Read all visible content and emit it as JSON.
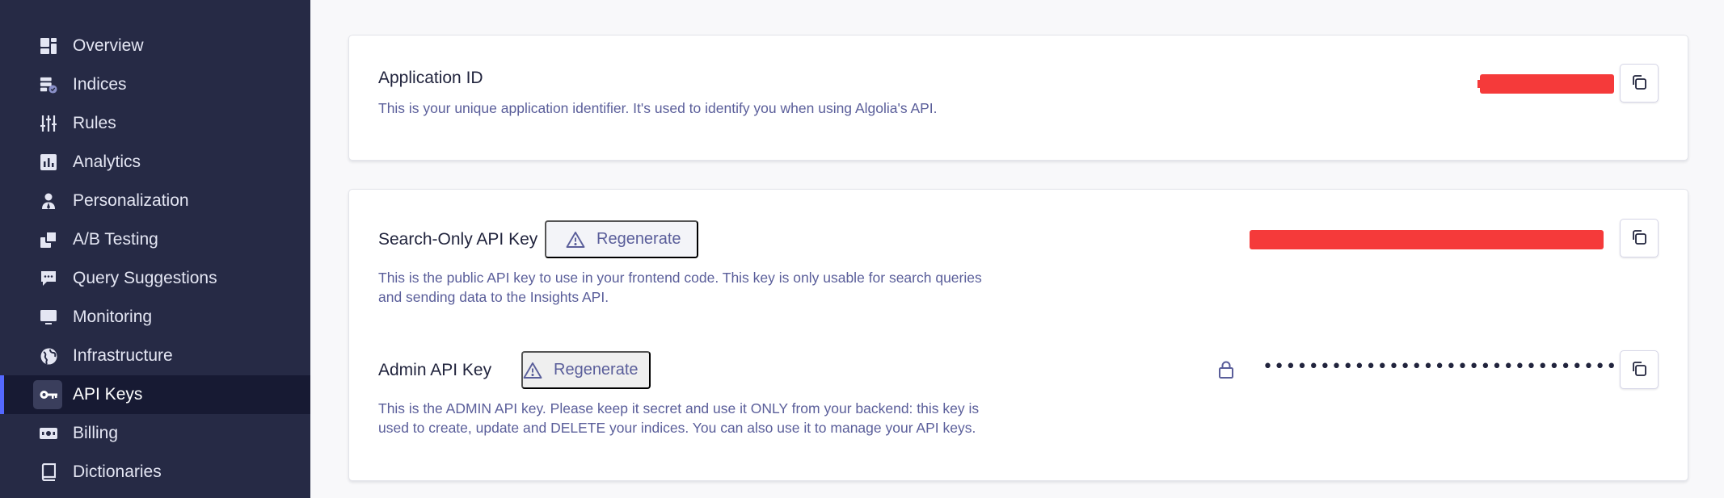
{
  "sidebar": {
    "items": [
      {
        "label": "Overview",
        "icon": "overview-icon"
      },
      {
        "label": "Indices",
        "icon": "indices-icon"
      },
      {
        "label": "Rules",
        "icon": "rules-icon"
      },
      {
        "label": "Analytics",
        "icon": "analytics-icon"
      },
      {
        "label": "Personalization",
        "icon": "personalization-icon"
      },
      {
        "label": "A/B Testing",
        "icon": "ab-testing-icon"
      },
      {
        "label": "Query Suggestions",
        "icon": "query-suggestions-icon"
      },
      {
        "label": "Monitoring",
        "icon": "monitoring-icon"
      },
      {
        "label": "Infrastructure",
        "icon": "infrastructure-icon"
      },
      {
        "label": "API Keys",
        "icon": "key-icon",
        "active": true
      },
      {
        "label": "Billing",
        "icon": "billing-icon"
      },
      {
        "label": "Dictionaries",
        "icon": "dictionaries-icon"
      }
    ]
  },
  "app_id": {
    "title": "Application ID",
    "description": "This is your unique application identifier. It's used to identify you when using Algolia's API."
  },
  "search_key": {
    "title": "Search-Only API Key",
    "regenerate_label": "Regenerate",
    "description_line1": "This is the public API key to use in your frontend code. This key is only usable for search queries",
    "description_line2": "and sending data to the Insights API."
  },
  "admin_key": {
    "title": "Admin API Key",
    "regenerate_label": "Regenerate",
    "masked_value": "••••••••••••••••••••••••••••••••",
    "description_line1": "This is the ADMIN API key. Please keep it secret and use it ONLY from your backend: this key is",
    "description_line2": "used to create, update and DELETE your indices. You can also use it to manage your API keys."
  },
  "colors": {
    "sidebar_bg": "#262a45",
    "active_bg": "#171a33",
    "accent": "#5468ff",
    "redaction": "#f53a3a"
  }
}
